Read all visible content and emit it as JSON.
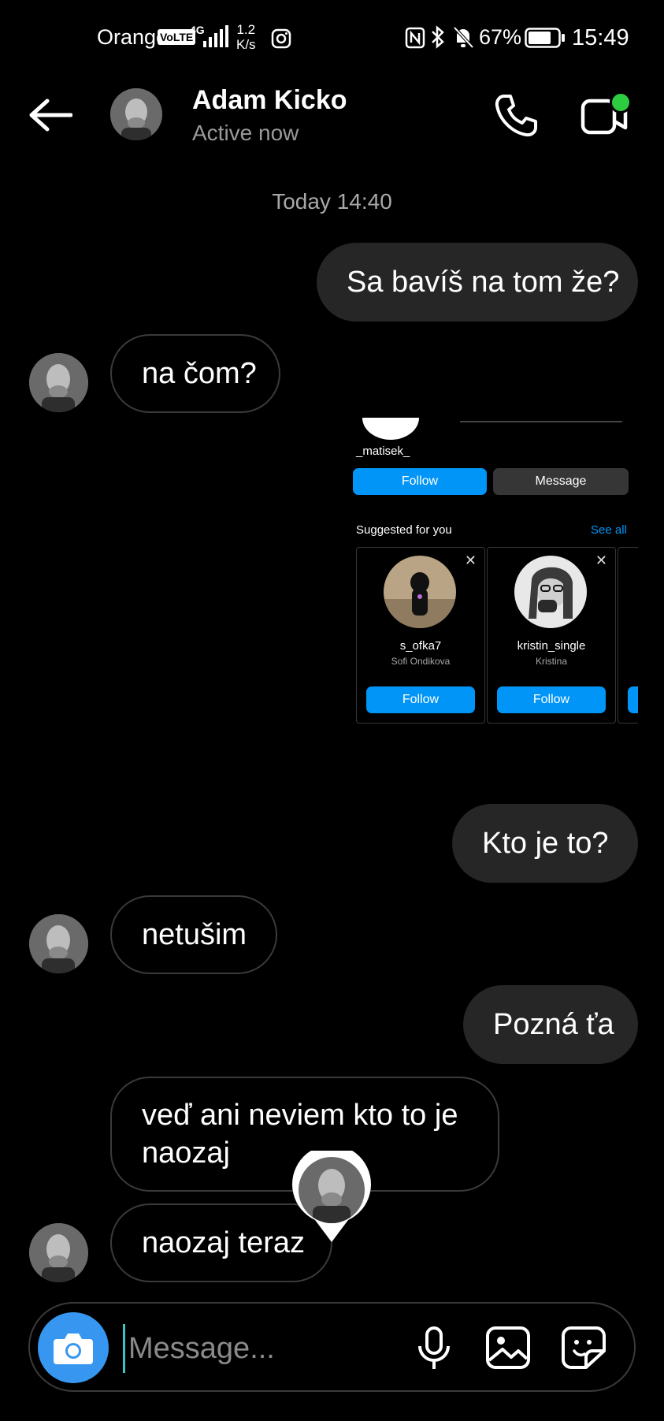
{
  "status_bar": {
    "carrier": "Orange",
    "volte": "VoLTE",
    "network": "4G",
    "speed_value": "1.2",
    "speed_unit": "K/s",
    "battery": "67%",
    "time": "15:49",
    "icons": [
      "instagram-icon",
      "nfc-icon",
      "bluetooth-icon",
      "mute-bell-icon",
      "battery-icon"
    ]
  },
  "header": {
    "name": "Adam Kicko",
    "presence": "Active now"
  },
  "conversation": {
    "timestamp": "Today 14:40",
    "messages": [
      {
        "direction": "out",
        "text": "Sa bavíš na tom že?"
      },
      {
        "direction": "in",
        "text": "na čom?"
      },
      {
        "direction": "out",
        "text": "Kto je to?"
      },
      {
        "direction": "in",
        "text": "netušim"
      },
      {
        "direction": "out",
        "text": "Pozná ťa"
      },
      {
        "direction": "in",
        "text": "veď ani neviem kto to je naozaj"
      },
      {
        "direction": "in",
        "text": "naozaj teraz"
      }
    ]
  },
  "shared_profile": {
    "username": "_matisek_",
    "follow_label": "Follow",
    "message_label": "Message",
    "suggested_title": "Suggested for you",
    "see_all": "See all",
    "suggestions": [
      {
        "username": "s_ofka7",
        "name": "Sofi Ondikova",
        "button": "Follow"
      },
      {
        "username": "kristin_single",
        "name": "Kristina",
        "button": "Follow"
      }
    ]
  },
  "composer": {
    "placeholder": "Message..."
  },
  "colors": {
    "accent": "#0095f6",
    "outgoing_bubble": "#262626",
    "camera_button": "#3797f0",
    "active_dot": "#2ecc40"
  }
}
